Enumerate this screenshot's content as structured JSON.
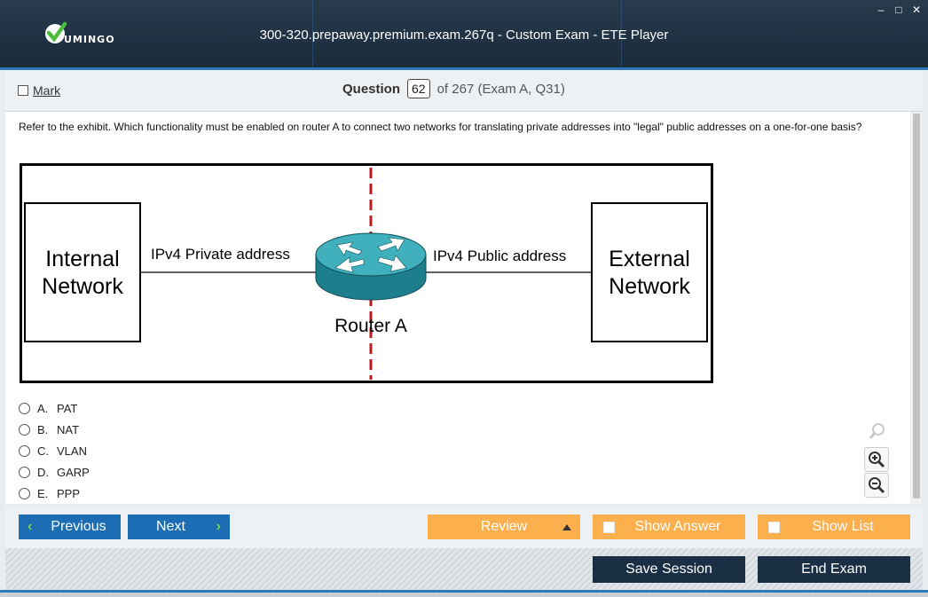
{
  "window": {
    "title": "300-320.prepaway.premium.exam.267q - Custom Exam - ETE Player",
    "logo_text": "UMINGO",
    "controls": {
      "minimize": "–",
      "maximize": "□",
      "close": "✕"
    }
  },
  "question_bar": {
    "mark_label": "Mark",
    "question_label": "Question",
    "question_number": "62",
    "question_of": "of 267 (Exam A, Q31)"
  },
  "question": {
    "text": "Refer to the exhibit. Which functionality must be enabled on router A to connect two networks for translating private addresses into \"legal\" public addresses on a one-for-one basis?"
  },
  "exhibit": {
    "left_box": "Internal Network",
    "left_box_line1": "Internal",
    "left_box_line2": "Network",
    "right_box_line1": "External",
    "right_box_line2": "Network",
    "left_link_label": "IPv4 Private address",
    "right_link_label": "IPv4 Public address",
    "router_label": "Router A"
  },
  "answers": [
    {
      "letter": "A.",
      "text": "PAT"
    },
    {
      "letter": "B.",
      "text": "NAT"
    },
    {
      "letter": "C.",
      "text": "VLAN"
    },
    {
      "letter": "D.",
      "text": "GARP"
    },
    {
      "letter": "E.",
      "text": "PPP"
    }
  ],
  "zoom_icons": [
    "magnifier-icon",
    "zoom-in-icon",
    "zoom-out-icon"
  ],
  "nav": {
    "previous": "Previous",
    "next": "Next",
    "review": "Review",
    "show_answer": "Show Answer",
    "show_list": "Show List",
    "save_session": "Save Session",
    "end_exam": "End Exam"
  },
  "colors": {
    "titlebar": "#1f3142",
    "accent_blue": "#1d6db5",
    "accent_orange": "#fcaf4d",
    "dark_button": "#1a2e44",
    "router": "#2e9aa6",
    "divider_red": "#c0161c"
  }
}
